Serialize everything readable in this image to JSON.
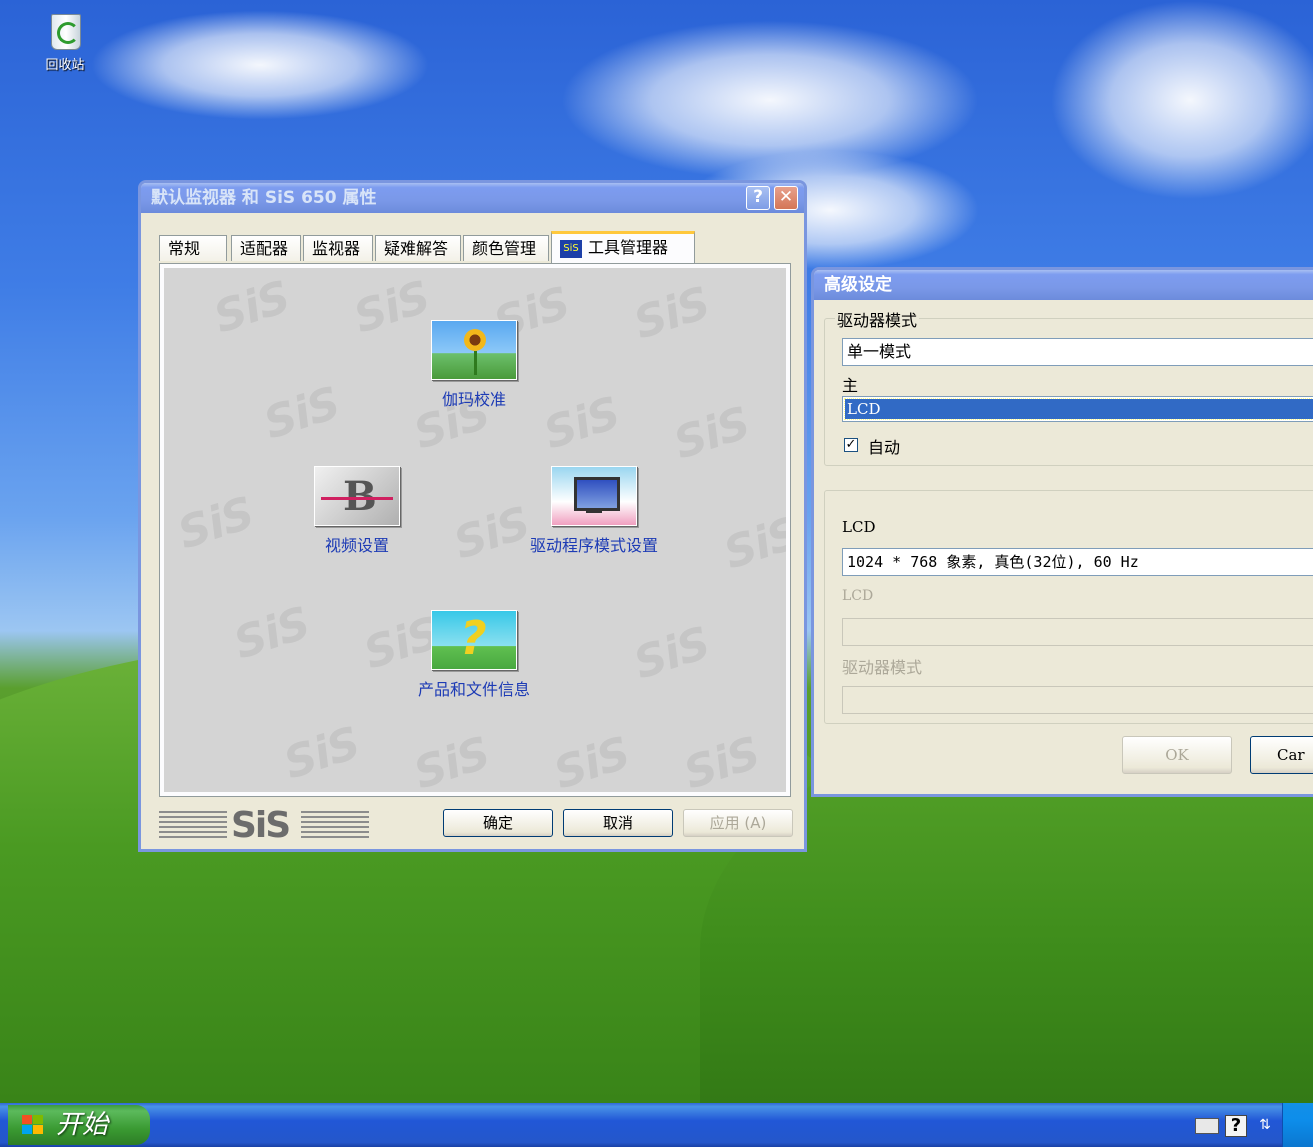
{
  "desktop": {
    "recycle_bin_label": "回收站"
  },
  "display_props": {
    "title": "默认监视器 和 SiS 650 属性",
    "help_glyph": "?",
    "close_glyph": "✕",
    "tabs": [
      "常规",
      "适配器",
      "监视器",
      "疑难解答",
      "颜色管理",
      "工具管理器"
    ],
    "active_tab_icon_text": "SiS",
    "watermark": "SiS",
    "tools": {
      "gamma": "伽玛校准",
      "video": "视频设置",
      "driver_mode": "驱动程序模式设置",
      "product_info": "产品和文件信息"
    },
    "logo_text": "SiS",
    "buttons": {
      "ok": "确定",
      "cancel": "取消",
      "apply": "应用 (A)"
    }
  },
  "advanced": {
    "title": "高级设定",
    "group1_legend": "驱动器模式",
    "mode_value": "单一模式",
    "primary_label": "主",
    "primary_value": "LCD",
    "auto_label": "自动",
    "auto_checked": true,
    "check_glyph": "✓",
    "lcd_label": "LCD",
    "resolution_value": "1024 * 768 象素, 真色(32位), 60 Hz",
    "lcd_label_disabled": "LCD",
    "driver_mode_label": "驱动器模式",
    "ok_label": "OK",
    "cancel_label": "Car"
  },
  "taskbar": {
    "start_label": "开始",
    "tray": {
      "keyboard_icon": "keyboard-icon",
      "help_icon": "help-icon",
      "help_glyph": "?",
      "restore_glyph": "⇅"
    }
  },
  "colors": {
    "title_active": "#0054e3",
    "window_face": "#ece9d8",
    "link_blue": "#1d3bb5",
    "tab_highlight": "#ffc83c"
  }
}
